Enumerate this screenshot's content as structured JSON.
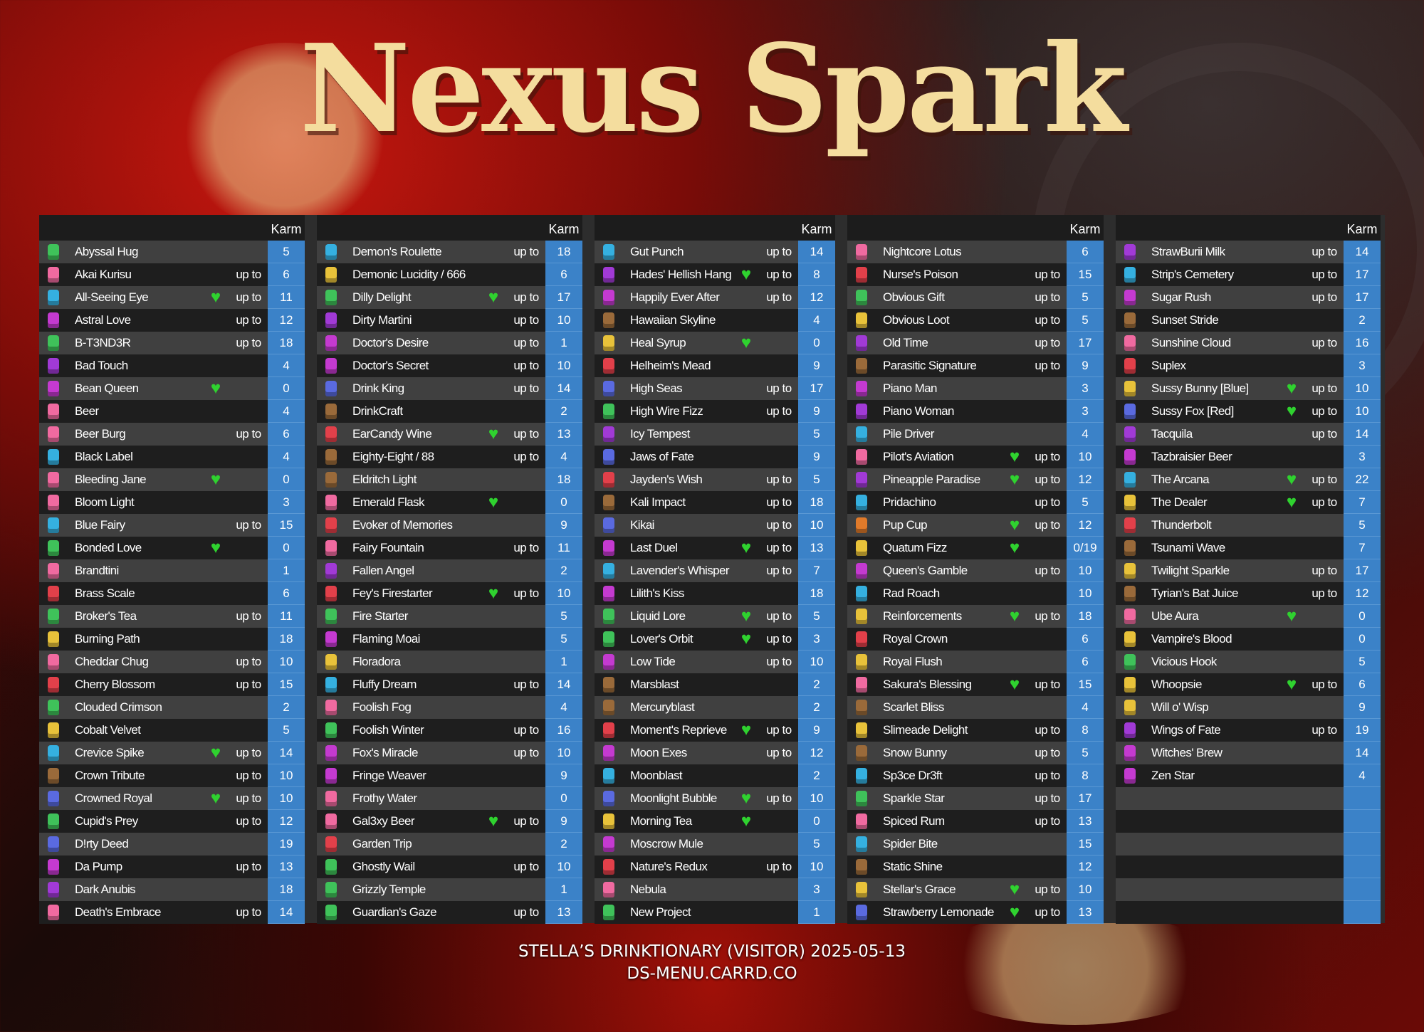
{
  "title": "Nexus Spark",
  "labels": {
    "karm": "Karm",
    "up_to": "up to",
    "heart": "♥"
  },
  "footer": {
    "line1": "STELLA’S DRINKTIONARY (VISITOR) 2025-05-13",
    "line2": "DS-MENU.CARRD.CO"
  },
  "colors": {
    "karm_bg": "#3b82c8",
    "heart": "#2fd22f",
    "title": "#f4dd9e"
  },
  "columns": [
    {
      "rows": [
        {
          "n": "Abyssal Hug",
          "f": false,
          "u": false,
          "k": "5"
        },
        {
          "n": "Akai Kurisu",
          "f": false,
          "u": true,
          "k": "6"
        },
        {
          "n": "All-Seeing Eye",
          "f": true,
          "u": true,
          "k": "11"
        },
        {
          "n": "Astral Love",
          "f": false,
          "u": true,
          "k": "12"
        },
        {
          "n": "B-T3ND3R",
          "f": false,
          "u": true,
          "k": "18"
        },
        {
          "n": "Bad Touch",
          "f": false,
          "u": false,
          "k": "4"
        },
        {
          "n": "Bean Queen",
          "f": true,
          "u": false,
          "k": "0"
        },
        {
          "n": "Beer",
          "f": false,
          "u": false,
          "k": "4"
        },
        {
          "n": "Beer Burg",
          "f": false,
          "u": true,
          "k": "6"
        },
        {
          "n": "Black Label",
          "f": false,
          "u": false,
          "k": "4"
        },
        {
          "n": "Bleeding Jane",
          "f": true,
          "u": false,
          "k": "0"
        },
        {
          "n": "Bloom Light",
          "f": false,
          "u": false,
          "k": "3"
        },
        {
          "n": "Blue Fairy",
          "f": false,
          "u": true,
          "k": "15"
        },
        {
          "n": "Bonded Love",
          "f": true,
          "u": false,
          "k": "0"
        },
        {
          "n": "Brandtini",
          "f": false,
          "u": false,
          "k": "1"
        },
        {
          "n": "Brass Scale",
          "f": false,
          "u": false,
          "k": "6"
        },
        {
          "n": "Broker's Tea",
          "f": false,
          "u": true,
          "k": "11"
        },
        {
          "n": "Burning Path",
          "f": false,
          "u": false,
          "k": "18"
        },
        {
          "n": "Cheddar Chug",
          "f": false,
          "u": true,
          "k": "10"
        },
        {
          "n": "Cherry Blossom",
          "f": false,
          "u": true,
          "k": "15"
        },
        {
          "n": "Clouded Crimson",
          "f": false,
          "u": false,
          "k": "2"
        },
        {
          "n": "Cobalt Velvet",
          "f": false,
          "u": false,
          "k": "5"
        },
        {
          "n": "Crevice Spike",
          "f": true,
          "u": true,
          "k": "14"
        },
        {
          "n": "Crown Tribute",
          "f": false,
          "u": true,
          "k": "10"
        },
        {
          "n": "Crowned Royal",
          "f": true,
          "u": true,
          "k": "10"
        },
        {
          "n": "Cupid's Prey",
          "f": false,
          "u": true,
          "k": "12"
        },
        {
          "n": "D!rty Deed",
          "f": false,
          "u": false,
          "k": "19"
        },
        {
          "n": "Da Pump",
          "f": false,
          "u": true,
          "k": "13"
        },
        {
          "n": "Dark Anubis",
          "f": false,
          "u": false,
          "k": "18"
        },
        {
          "n": "Death's Embrace",
          "f": false,
          "u": true,
          "k": "14"
        }
      ]
    },
    {
      "rows": [
        {
          "n": "Demon's Roulette",
          "f": false,
          "u": true,
          "k": "18"
        },
        {
          "n": "Demonic Lucidity / 666",
          "f": false,
          "u": false,
          "k": "6"
        },
        {
          "n": "Dilly Delight",
          "f": true,
          "u": true,
          "k": "17"
        },
        {
          "n": "Dirty Martini",
          "f": false,
          "u": true,
          "k": "10"
        },
        {
          "n": "Doctor's Desire",
          "f": false,
          "u": true,
          "k": "1"
        },
        {
          "n": "Doctor's Secret",
          "f": false,
          "u": true,
          "k": "10"
        },
        {
          "n": "Drink King",
          "f": false,
          "u": true,
          "k": "14"
        },
        {
          "n": "DrinkCraft",
          "f": false,
          "u": false,
          "k": "2"
        },
        {
          "n": "EarCandy Wine",
          "f": true,
          "u": true,
          "k": "13"
        },
        {
          "n": "Eighty-Eight / 88",
          "f": false,
          "u": true,
          "k": "4"
        },
        {
          "n": "Eldritch Light",
          "f": false,
          "u": false,
          "k": "18"
        },
        {
          "n": "Emerald Flask",
          "f": true,
          "u": false,
          "k": "0"
        },
        {
          "n": "Evoker of Memories",
          "f": false,
          "u": false,
          "k": "9"
        },
        {
          "n": "Fairy Fountain",
          "f": false,
          "u": true,
          "k": "11"
        },
        {
          "n": "Fallen Angel",
          "f": false,
          "u": false,
          "k": "2"
        },
        {
          "n": "Fey's Firestarter",
          "f": true,
          "u": true,
          "k": "10"
        },
        {
          "n": "Fire Starter",
          "f": false,
          "u": false,
          "k": "5"
        },
        {
          "n": "Flaming Moai",
          "f": false,
          "u": false,
          "k": "5"
        },
        {
          "n": "Floradora",
          "f": false,
          "u": false,
          "k": "1"
        },
        {
          "n": "Fluffy Dream",
          "f": false,
          "u": true,
          "k": "14"
        },
        {
          "n": "Foolish Fog",
          "f": false,
          "u": false,
          "k": "4"
        },
        {
          "n": "Foolish Winter",
          "f": false,
          "u": true,
          "k": "16"
        },
        {
          "n": "Fox's Miracle",
          "f": false,
          "u": true,
          "k": "10"
        },
        {
          "n": "Fringe Weaver",
          "f": false,
          "u": false,
          "k": "9"
        },
        {
          "n": "Frothy Water",
          "f": false,
          "u": false,
          "k": "0"
        },
        {
          "n": "Gal3xy Beer",
          "f": true,
          "u": true,
          "k": "9"
        },
        {
          "n": "Garden Trip",
          "f": false,
          "u": false,
          "k": "2"
        },
        {
          "n": "Ghostly Wail",
          "f": false,
          "u": true,
          "k": "10"
        },
        {
          "n": "Grizzly Temple",
          "f": false,
          "u": false,
          "k": "1"
        },
        {
          "n": "Guardian's Gaze",
          "f": false,
          "u": true,
          "k": "13"
        }
      ]
    },
    {
      "rows": [
        {
          "n": "Gut Punch",
          "f": false,
          "u": true,
          "k": "14"
        },
        {
          "n": "Hades' Hellish Hang",
          "f": true,
          "u": true,
          "k": "8"
        },
        {
          "n": "Happily Ever After",
          "f": false,
          "u": true,
          "k": "12"
        },
        {
          "n": "Hawaiian Skyline",
          "f": false,
          "u": false,
          "k": "4"
        },
        {
          "n": "Heal Syrup",
          "f": true,
          "u": false,
          "k": "0"
        },
        {
          "n": "Helheim's Mead",
          "f": false,
          "u": false,
          "k": "9"
        },
        {
          "n": "High Seas",
          "f": false,
          "u": true,
          "k": "17"
        },
        {
          "n": "High Wire Fizz",
          "f": false,
          "u": true,
          "k": "9"
        },
        {
          "n": "Icy Tempest",
          "f": false,
          "u": false,
          "k": "5"
        },
        {
          "n": "Jaws of Fate",
          "f": false,
          "u": false,
          "k": "9"
        },
        {
          "n": "Jayden's Wish",
          "f": false,
          "u": true,
          "k": "5"
        },
        {
          "n": "Kali Impact",
          "f": false,
          "u": true,
          "k": "18"
        },
        {
          "n": "Kikai",
          "f": false,
          "u": true,
          "k": "10"
        },
        {
          "n": "Last Duel",
          "f": true,
          "u": true,
          "k": "13"
        },
        {
          "n": "Lavender's Whisper",
          "f": false,
          "u": true,
          "k": "7"
        },
        {
          "n": "Lilith's Kiss",
          "f": false,
          "u": false,
          "k": "18"
        },
        {
          "n": "Liquid Lore",
          "f": true,
          "u": true,
          "k": "5"
        },
        {
          "n": "Lover's Orbit",
          "f": true,
          "u": true,
          "k": "3"
        },
        {
          "n": "Low Tide",
          "f": false,
          "u": true,
          "k": "10"
        },
        {
          "n": "Marsblast",
          "f": false,
          "u": false,
          "k": "2"
        },
        {
          "n": "Mercuryblast",
          "f": false,
          "u": false,
          "k": "2"
        },
        {
          "n": "Moment's Reprieve",
          "f": true,
          "u": true,
          "k": "9"
        },
        {
          "n": "Moon Exes",
          "f": false,
          "u": true,
          "k": "12"
        },
        {
          "n": "Moonblast",
          "f": false,
          "u": false,
          "k": "2"
        },
        {
          "n": "Moonlight Bubble",
          "f": true,
          "u": true,
          "k": "10"
        },
        {
          "n": "Morning Tea",
          "f": true,
          "u": false,
          "k": "0"
        },
        {
          "n": "Moscrow Mule",
          "f": false,
          "u": false,
          "k": "5"
        },
        {
          "n": "Nature's Redux",
          "f": false,
          "u": true,
          "k": "10"
        },
        {
          "n": "Nebula",
          "f": false,
          "u": false,
          "k": "3"
        },
        {
          "n": "New Project",
          "f": false,
          "u": false,
          "k": "1"
        }
      ]
    },
    {
      "rows": [
        {
          "n": "Nightcore Lotus",
          "f": false,
          "u": false,
          "k": "6"
        },
        {
          "n": "Nurse's Poison",
          "f": false,
          "u": true,
          "k": "15"
        },
        {
          "n": "Obvious Gift",
          "f": false,
          "u": true,
          "k": "5"
        },
        {
          "n": "Obvious Loot",
          "f": false,
          "u": true,
          "k": "5"
        },
        {
          "n": "Old Time",
          "f": false,
          "u": true,
          "k": "17"
        },
        {
          "n": "Parasitic Signature",
          "f": false,
          "u": true,
          "k": "9"
        },
        {
          "n": "Piano Man",
          "f": false,
          "u": false,
          "k": "3"
        },
        {
          "n": "Piano Woman",
          "f": false,
          "u": false,
          "k": "3"
        },
        {
          "n": "Pile Driver",
          "f": false,
          "u": false,
          "k": "4"
        },
        {
          "n": "Pilot's Aviation",
          "f": true,
          "u": true,
          "k": "10"
        },
        {
          "n": "Pineapple Paradise",
          "f": true,
          "u": true,
          "k": "12"
        },
        {
          "n": "Pridachino",
          "f": false,
          "u": true,
          "k": "5"
        },
        {
          "n": "Pup Cup",
          "f": true,
          "u": true,
          "k": "12"
        },
        {
          "n": "Quatum Fizz",
          "f": true,
          "u": false,
          "k": "0/19"
        },
        {
          "n": "Queen's Gamble",
          "f": false,
          "u": true,
          "k": "10"
        },
        {
          "n": "Rad Roach",
          "f": false,
          "u": false,
          "k": "10"
        },
        {
          "n": "Reinforcements",
          "f": true,
          "u": true,
          "k": "18"
        },
        {
          "n": "Royal Crown",
          "f": false,
          "u": false,
          "k": "6"
        },
        {
          "n": "Royal Flush",
          "f": false,
          "u": false,
          "k": "6"
        },
        {
          "n": "Sakura's Blessing",
          "f": true,
          "u": true,
          "k": "15"
        },
        {
          "n": "Scarlet Bliss",
          "f": false,
          "u": false,
          "k": "4"
        },
        {
          "n": "Slimeade Delight",
          "f": false,
          "u": true,
          "k": "8"
        },
        {
          "n": "Snow Bunny",
          "f": false,
          "u": true,
          "k": "5"
        },
        {
          "n": "Sp3ce Dr3ft",
          "f": false,
          "u": true,
          "k": "8"
        },
        {
          "n": "Sparkle Star",
          "f": false,
          "u": true,
          "k": "17"
        },
        {
          "n": "Spiced Rum",
          "f": false,
          "u": true,
          "k": "13"
        },
        {
          "n": "Spider Bite",
          "f": false,
          "u": false,
          "k": "15"
        },
        {
          "n": "Static Shine",
          "f": false,
          "u": false,
          "k": "12"
        },
        {
          "n": "Stellar's Grace",
          "f": true,
          "u": true,
          "k": "10"
        },
        {
          "n": "Strawberry Lemonade",
          "f": true,
          "u": true,
          "k": "13"
        }
      ]
    },
    {
      "rows": [
        {
          "n": "StrawBurii Milk",
          "f": false,
          "u": true,
          "k": "14"
        },
        {
          "n": "Strip's Cemetery",
          "f": false,
          "u": true,
          "k": "17"
        },
        {
          "n": "Sugar Rush",
          "f": false,
          "u": true,
          "k": "17"
        },
        {
          "n": "Sunset Stride",
          "f": false,
          "u": false,
          "k": "2"
        },
        {
          "n": "Sunshine Cloud",
          "f": false,
          "u": true,
          "k": "16"
        },
        {
          "n": "Suplex",
          "f": false,
          "u": false,
          "k": "3"
        },
        {
          "n": "Sussy Bunny [Blue]",
          "f": true,
          "u": true,
          "k": "10"
        },
        {
          "n": "Sussy Fox [Red]",
          "f": true,
          "u": true,
          "k": "10"
        },
        {
          "n": "Tacquila",
          "f": false,
          "u": true,
          "k": "14"
        },
        {
          "n": "Tazbraisier Beer",
          "f": false,
          "u": false,
          "k": "3"
        },
        {
          "n": "The Arcana",
          "f": true,
          "u": true,
          "k": "22"
        },
        {
          "n": "The Dealer",
          "f": true,
          "u": true,
          "k": "7"
        },
        {
          "n": "Thunderbolt",
          "f": false,
          "u": false,
          "k": "5"
        },
        {
          "n": "Tsunami Wave",
          "f": false,
          "u": false,
          "k": "7"
        },
        {
          "n": "Twilight Sparkle",
          "f": false,
          "u": true,
          "k": "17"
        },
        {
          "n": "Tyrian's Bat Juice",
          "f": false,
          "u": true,
          "k": "12"
        },
        {
          "n": "Ube Aura",
          "f": true,
          "u": false,
          "k": "0"
        },
        {
          "n": "Vampire's Blood",
          "f": false,
          "u": false,
          "k": "0"
        },
        {
          "n": "Vicious Hook",
          "f": false,
          "u": false,
          "k": "5"
        },
        {
          "n": "Whoopsie",
          "f": true,
          "u": true,
          "k": "6"
        },
        {
          "n": "Will o' Wisp",
          "f": false,
          "u": false,
          "k": "9"
        },
        {
          "n": "Wings of Fate",
          "f": false,
          "u": true,
          "k": "19"
        },
        {
          "n": "Witches' Brew",
          "f": false,
          "u": false,
          "k": "14"
        },
        {
          "n": "Zen Star",
          "f": false,
          "u": false,
          "k": "4"
        }
      ]
    }
  ]
}
